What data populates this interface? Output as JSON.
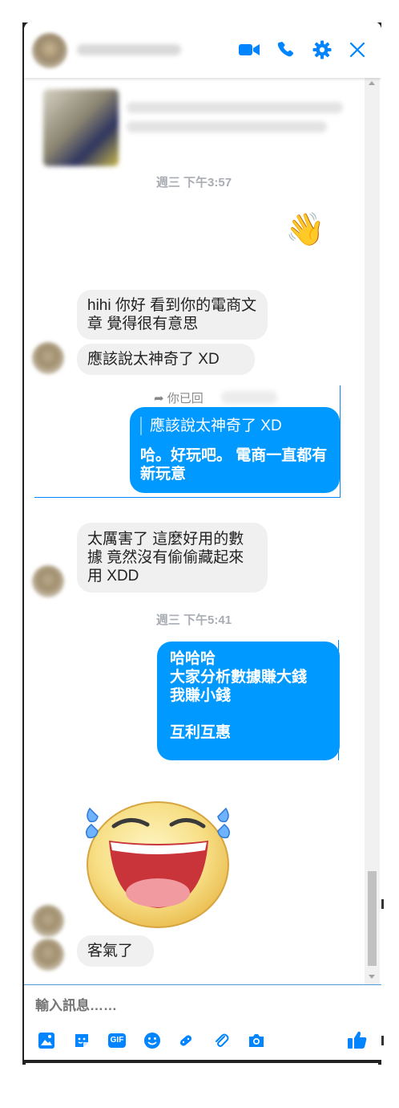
{
  "colors": {
    "accent": "#0099ff",
    "incoming_bubble": "#f0f0f0",
    "timestamp": "#a9adb3"
  },
  "header": {
    "icons": [
      "video-call-icon",
      "phone-icon",
      "gear-icon",
      "close-icon"
    ]
  },
  "messages": {
    "timestamp_1": "週三 下午3:57",
    "wave_emoji": "👋",
    "in_1a": "hihi 你好 看到你的電商文章 覺得很有意思",
    "in_1b": "應該說太神奇了 XD",
    "reply_header": "你已回",
    "reply_quote": "應該說太神奇了 XD",
    "out_1": "哈。好玩吧。 電商一直都有新玩意",
    "in_2": "太厲害了 這麼好用的數據 竟然沒有偷偷藏起來用 XDD",
    "timestamp_2": "週三 下午5:41",
    "out_2_line1": "哈哈哈",
    "out_2_line2": "大家分析數據賺大錢",
    "out_2_line3": "我賺小錢",
    "out_2_line4": "互利互惠",
    "sticker": "laughing-face-sticker",
    "in_3": "客氣了"
  },
  "composer": {
    "placeholder": "輸入訊息……",
    "toolbar_icons": [
      "photo-icon",
      "sticker-icon",
      "gif-icon",
      "emoji-icon",
      "game-icon",
      "attachment-icon",
      "camera-icon",
      "like-icon"
    ],
    "gif_label": "GIF"
  }
}
